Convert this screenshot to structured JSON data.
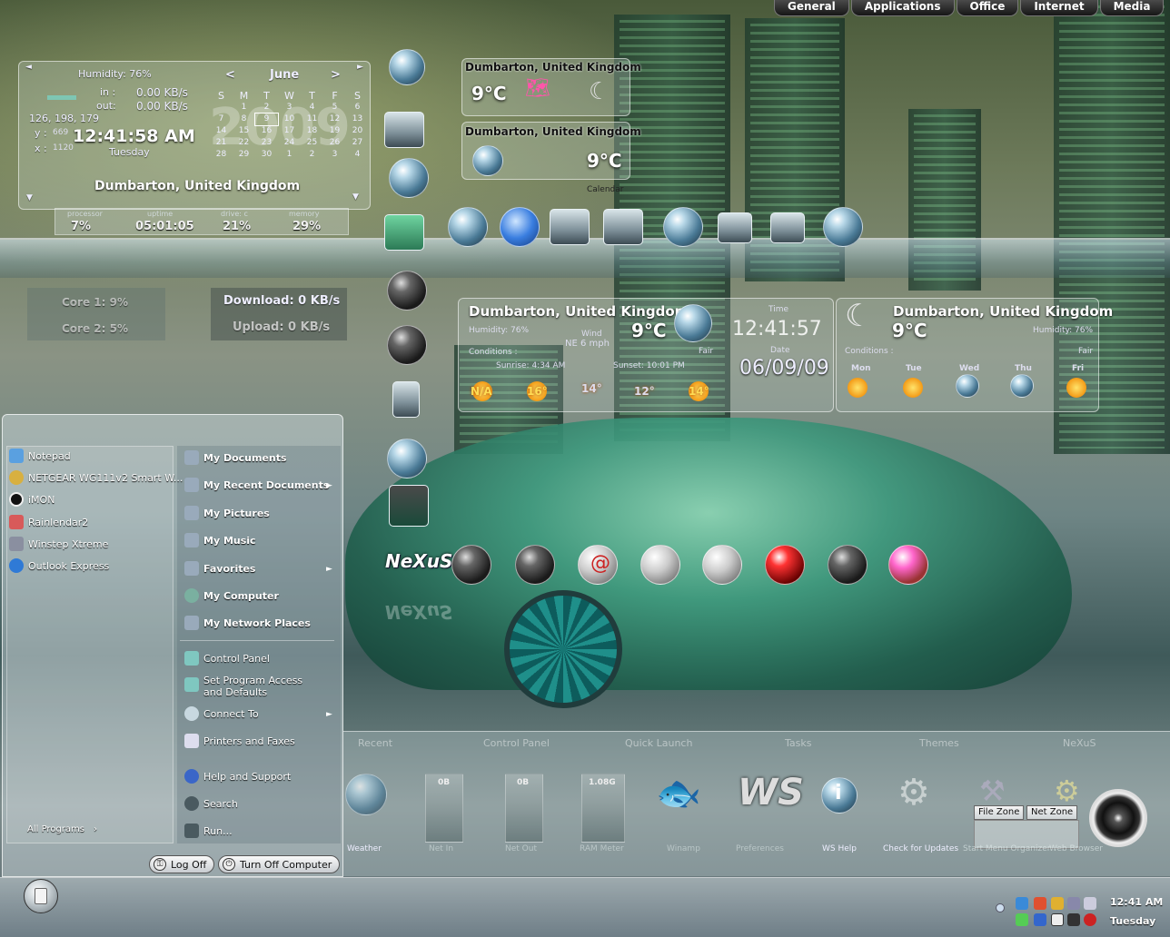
{
  "top_menu": [
    "General",
    "Applications",
    "Office",
    "Internet",
    "Media"
  ],
  "sysinfo_widget": {
    "humidity": "Humidity: 76%",
    "in_label": "in :",
    "in_value": "0.00 KB/s",
    "out_label": "out:",
    "out_value": "0.00 KB/s",
    "color": "126, 198, 179",
    "y_label": "y :",
    "y_value": "669",
    "x_label": "x :",
    "x_value": "1120",
    "time": "12:41:58 AM",
    "day": "Tuesday",
    "year_watermark": "2009",
    "month": "June",
    "prev": "<",
    "next": ">",
    "weekdays": [
      "S",
      "M",
      "T",
      "W",
      "T",
      "F",
      "S"
    ],
    "days": [
      "",
      "1",
      "2",
      "3",
      "4",
      "5",
      "6",
      "7",
      "8",
      "9",
      "10",
      "11",
      "12",
      "13",
      "14",
      "15",
      "16",
      "17",
      "18",
      "19",
      "20",
      "21",
      "22",
      "23",
      "24",
      "25",
      "26",
      "27",
      "28",
      "29",
      "30",
      "1",
      "2",
      "3",
      "4"
    ],
    "today": "9",
    "location": "Dumbarton, United Kingdom",
    "stats": [
      {
        "label": "processor",
        "value": "7%"
      },
      {
        "label": "uptime",
        "value": "05:01:05"
      },
      {
        "label": "drive: c",
        "value": "21%"
      },
      {
        "label": "memory",
        "value": "29%"
      }
    ]
  },
  "core_widget": {
    "core1": "Core 1:  9%",
    "core2": "Core 2:  5%"
  },
  "net_widget": {
    "download": "Download: 0 KB/s",
    "upload": "Upload: 0 KB/s"
  },
  "weather_small_1": {
    "location": "Dumbarton, United Kingdom",
    "temp": "9°C"
  },
  "weather_small_2": {
    "location": "Dumbarton, United Kingdom",
    "temp": "9°C",
    "footer": "Calendar"
  },
  "weather_big": {
    "location": "Dumbarton, United Kingdom",
    "humidity": "Humidity: 76%",
    "temp": "9°C",
    "wind_label": "Wind",
    "wind": "NE 6 mph",
    "fair": "Fair",
    "conditions": "Conditions :",
    "sunrise": "Sunrise: 4:34 AM",
    "sunset": "Sunset: 10:01 PM",
    "forecast_temps": [
      "N/A",
      "16°",
      "14°",
      "12°",
      "14°"
    ],
    "time_label": "Time",
    "time": "12:41:57",
    "date_label": "Date",
    "date": "06/09/09"
  },
  "weather_right": {
    "location": "Dumbarton, United Kingdom",
    "temp": "9°C",
    "humidity": "Humidity: 76%",
    "conditions": "Conditions :",
    "fair": "Fair",
    "days": [
      "Mon",
      "Tue",
      "Wed",
      "Thu",
      "Fri"
    ]
  },
  "start_menu": {
    "pinned": [
      "Notepad",
      "NETGEAR WG111v2 Smart W...",
      "iMON",
      "Rainlendar2",
      "Winstep Xtreme",
      "Outlook Express"
    ],
    "all_programs": "All Programs",
    "right_top": [
      "My Documents",
      "My Recent Documents",
      "My Pictures",
      "My Music",
      "Favorites",
      "My Computer",
      "My Network Places"
    ],
    "right_bottom": [
      "Control Panel",
      "Set Program Access and Defaults",
      "Connect To",
      "Printers and Faxes",
      "Help and Support",
      "Search",
      "Run..."
    ],
    "log_off": "Log Off",
    "turn_off": "Turn Off Computer"
  },
  "dock": {
    "tabs": [
      "Recent",
      "Control Panel",
      "Quick Launch",
      "Tasks",
      "Themes",
      "NeXuS"
    ],
    "labels": [
      "Weather",
      "Net In",
      "Net Out",
      "RAM Meter",
      "Winamp",
      "Preferences",
      "WS Help",
      "Check for Updates",
      "Start Menu Organizer",
      "Web Browser"
    ],
    "net_in": "0B",
    "net_out": "0B",
    "ram": "1.08G",
    "file_zone": "File Zone",
    "net_zone": "Net Zone"
  },
  "nexus_logo": "NeXuS",
  "taskbar": {
    "time": "12:41 AM",
    "day": "Tuesday"
  }
}
